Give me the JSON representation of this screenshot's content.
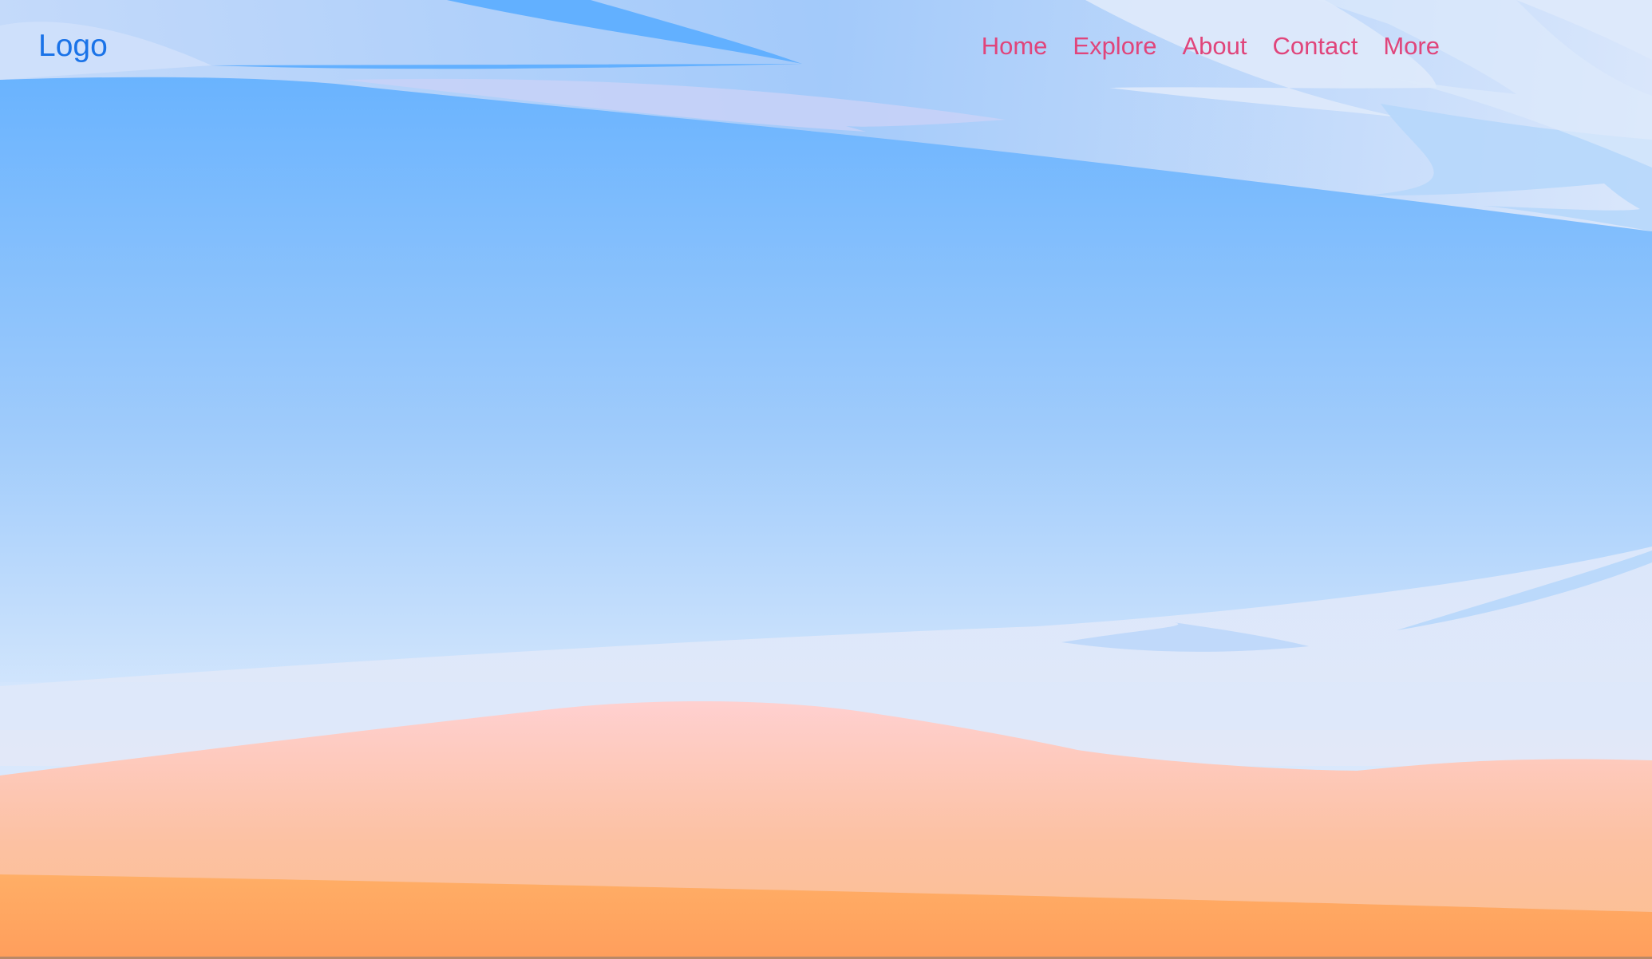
{
  "header": {
    "logo_label": "Logo",
    "nav": [
      {
        "label": "Home"
      },
      {
        "label": "Explore"
      },
      {
        "label": "About"
      },
      {
        "label": "Contact"
      },
      {
        "label": "More"
      }
    ]
  },
  "colors": {
    "logo": "#1a73e8",
    "nav_link": "#e0457b",
    "sky_top": "#5eaeff",
    "sky_mid": "#9fcbfb",
    "sky_bottom": "#d7e8fd",
    "cloud_light": "#dde9fb",
    "cloud_pale": "#c9dcfa",
    "cloud_blue": "#a9d0fb",
    "cloud_lilac": "#c7d2f7",
    "dune_pink": "#ffd0d0",
    "dune_peach": "#fbbf8f",
    "sand_orange": "#ffa860",
    "sand_deep": "#ff9e5c"
  }
}
